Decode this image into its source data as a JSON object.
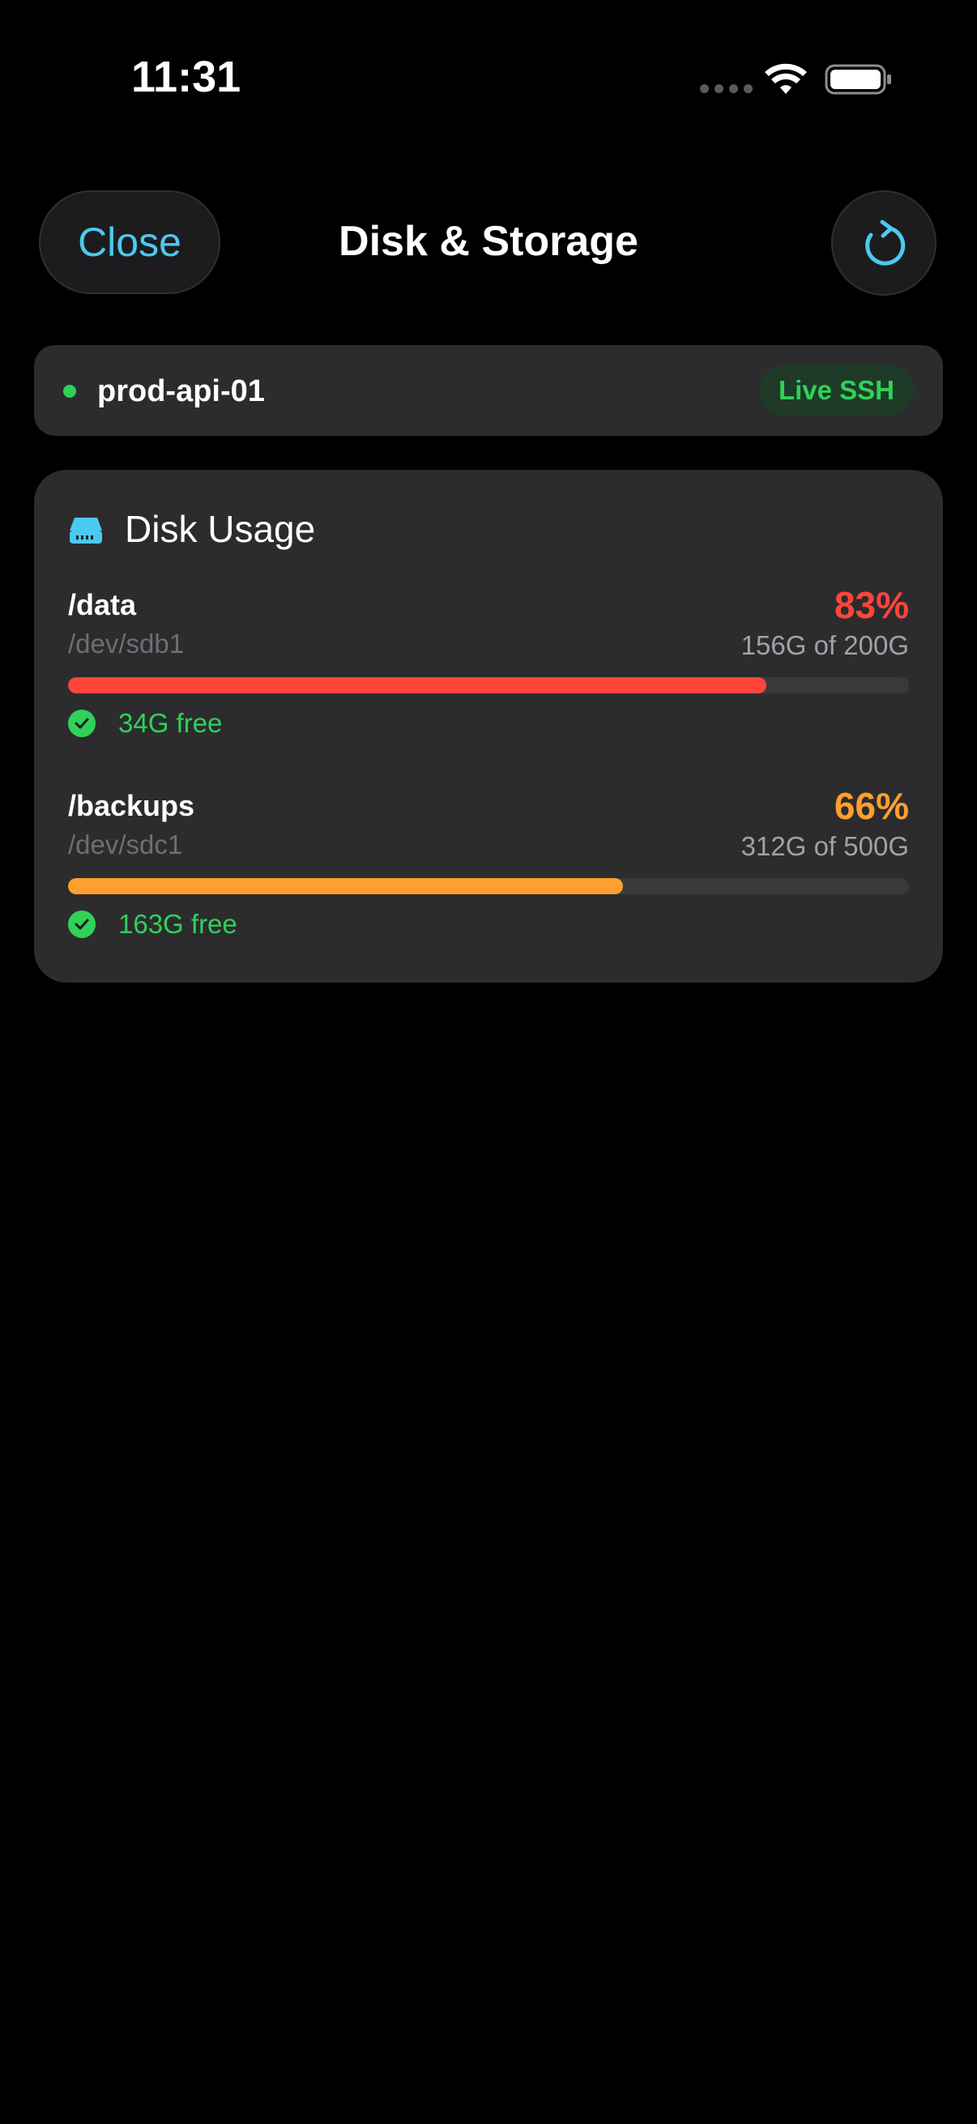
{
  "status_bar": {
    "time": "11:31",
    "icons": [
      "signal-dots-icon",
      "wifi-icon",
      "battery-icon"
    ]
  },
  "header": {
    "close_label": "Close",
    "title": "Disk & Storage",
    "refresh_icon": "refresh-icon",
    "accent_color": "#4cc9f0"
  },
  "server": {
    "name": "prod-api-01",
    "status_color": "#30d158",
    "badge": "Live SSH"
  },
  "disk_usage": {
    "title": "Disk Usage",
    "icon": "drive-icon",
    "disks": [
      {
        "mount": "/data",
        "device": "/dev/sdb1",
        "percent_label": "83%",
        "percent": 83,
        "usage": "156G of 200G",
        "free": "34G free",
        "color": "#ff453a"
      },
      {
        "mount": "/backups",
        "device": "/dev/sdc1",
        "percent_label": "66%",
        "percent": 66,
        "usage": "312G of 500G",
        "free": "163G free",
        "color": "#ff9f2e"
      }
    ]
  }
}
